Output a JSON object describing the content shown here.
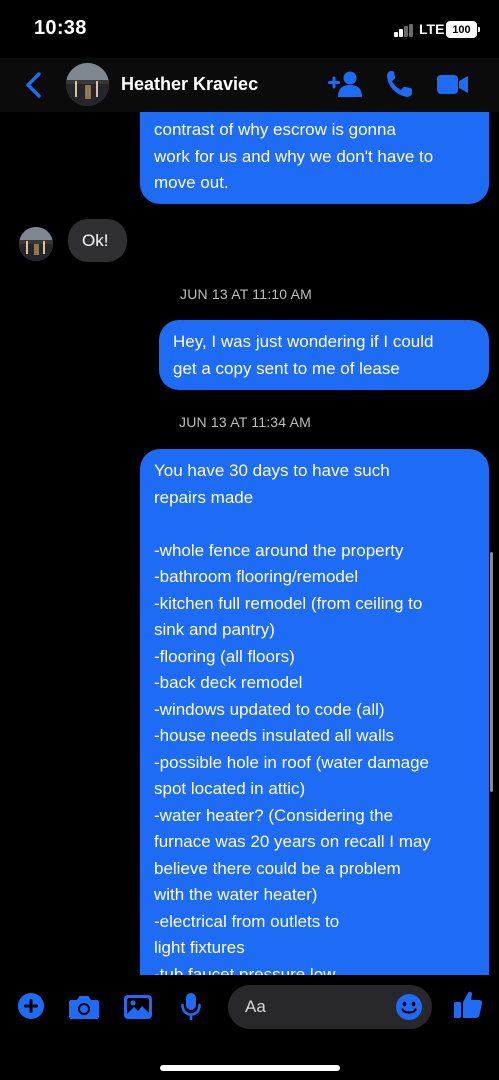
{
  "status_bar": {
    "time": "10:38",
    "network": "LTE",
    "battery": "100"
  },
  "header": {
    "contact_name": "Heather Kraviec",
    "icons": [
      "back-chevron-icon",
      "avatar",
      "add-person-icon",
      "phone-icon",
      "video-camera-icon"
    ],
    "accent_color": "#1e6bf5"
  },
  "messages": [
    {
      "direction": "outgoing",
      "text": "contrast of why escrow is gonna\nwork for us and why we don't have to\nmove out."
    },
    {
      "direction": "incoming",
      "text": "Ok!"
    },
    {
      "type": "timestamp",
      "text": "JUN 13 AT 11:10 AM"
    },
    {
      "direction": "outgoing",
      "text": "Hey, I was just wondering if I could\nget a copy sent to me of lease"
    },
    {
      "type": "timestamp",
      "text": "JUN 13 AT 11:34 AM"
    },
    {
      "direction": "outgoing",
      "text": "You have 30 days to have such\nrepairs made\n\n-whole fence around the property\n-bathroom flooring/remodel\n-kitchen full remodel (from ceiling to\nsink and pantry)\n-flooring (all floors)\n-back deck remodel\n-windows updated to code (all)\n-house needs insulated all walls\n-possible hole in roof (water damage\nspot located in attic)\n-water heater? (Considering the\nfurnace was 20 years on recall I may\nbelieve there could be a problem\nwith the water heater)\n-electrical from outlets to\nlight fixtures\n-tub faucet pressure low"
    }
  ],
  "composer": {
    "placeholder": "Aa",
    "icons": [
      "plus-icon",
      "camera-icon",
      "image-icon",
      "microphone-icon",
      "emoji-icon",
      "thumbs-up-icon"
    ],
    "icon_color": "#1e6bf5"
  }
}
